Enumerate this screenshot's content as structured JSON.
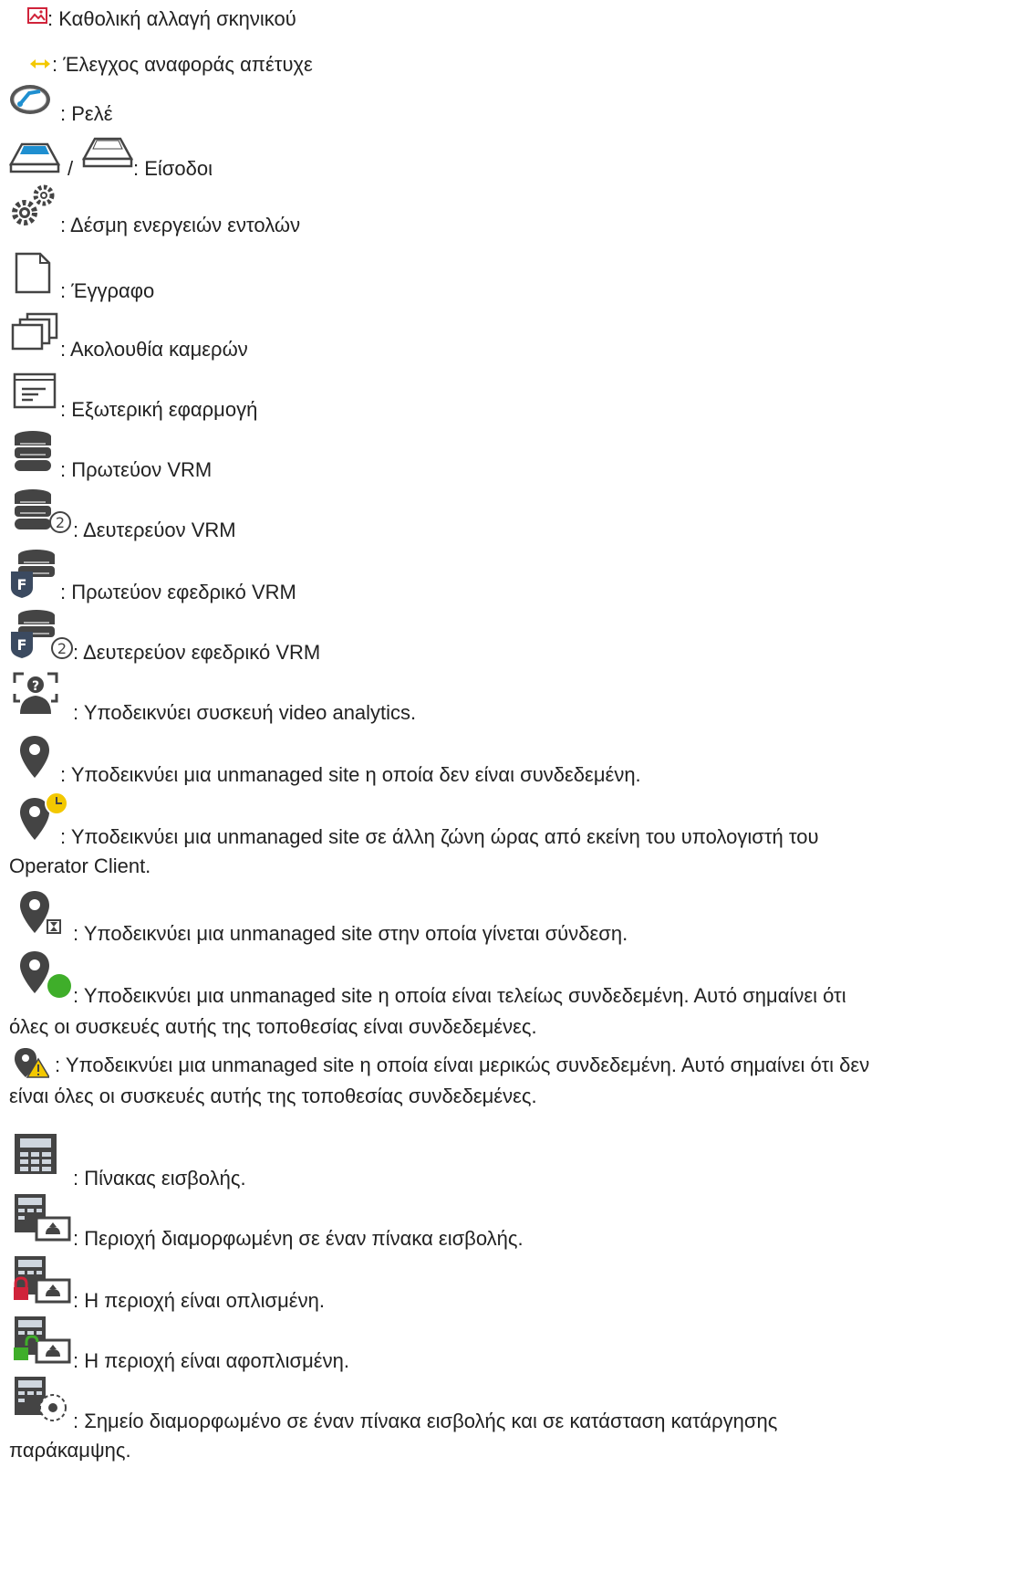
{
  "items": [
    {
      "icon": "scene-change-icon",
      "text": ": Καθολική αλλαγή σκηνικού"
    },
    {
      "icon": "reference-check-failed-icon",
      "text": ": Έλεγχος αναφοράς απέτυχε"
    },
    {
      "icon": "relay-icon",
      "text": ": Ρελέ"
    },
    {
      "icon": "input-icon",
      "separator": "/",
      "text": ": Είσοδοι"
    },
    {
      "icon": "command-script-icon",
      "text": ": Δέσμη ενεργειών εντολών"
    },
    {
      "icon": "document-icon",
      "text": ": Έγγραφο"
    },
    {
      "icon": "camera-sequence-icon",
      "text": ": Ακολουθία καμερών"
    },
    {
      "icon": "external-application-icon",
      "text": ": Εξωτερική εφαρμογή"
    },
    {
      "icon": "primary-vrm-icon",
      "text": ": Πρωτεύον VRM"
    },
    {
      "icon": "secondary-vrm-icon",
      "text": ": Δευτερεύον VRM"
    },
    {
      "icon": "primary-failover-vrm-icon",
      "text": ": Πρωτεύον εφεδρικό VRM"
    },
    {
      "icon": "secondary-failover-vrm-icon",
      "text": ": Δευτερεύον εφεδρικό VRM"
    },
    {
      "icon": "video-analytics-icon",
      "text": ": Υποδεικνύει συσκευή video analytics."
    },
    {
      "icon": "site-disconnected-icon",
      "text": ": Υποδεικνύει μια unmanaged site η οποία δεν είναι συνδεδεμένη."
    },
    {
      "icon": "site-timezone-icon",
      "text": ": Υποδεικνύει μια unmanaged site σε άλλη ζώνη ώρας από εκείνη του υπολογιστή του",
      "text2": "Operator Client."
    },
    {
      "icon": "site-connecting-icon",
      "text": ": Υποδεικνύει μια unmanaged site στην οποία γίνεται σύνδεση."
    },
    {
      "icon": "site-connected-icon",
      "text": ": Υποδεικνύει μια unmanaged site η οποία είναι τελείως συνδεδεμένη. Αυτό σημαίνει ότι",
      "text2": "όλες οι συσκευές αυτής της τοποθεσίας είναι συνδεδεμένες."
    },
    {
      "icon": "site-partially-connected-icon",
      "text": ": Υποδεικνύει μια unmanaged site η οποία είναι μερικώς συνδεδεμένη. Αυτό σημαίνει ότι δεν",
      "text2": "είναι όλες οι συσκευές αυτής της τοποθεσίας συνδεδεμένες."
    },
    {
      "icon": "intrusion-panel-icon",
      "text": ": Πίνακας εισβολής."
    },
    {
      "icon": "intrusion-area-icon",
      "text": ": Περιοχή διαμορφωμένη σε έναν πίνακα εισβολής."
    },
    {
      "icon": "area-armed-icon",
      "text": ": Η περιοχή είναι οπλισμένη."
    },
    {
      "icon": "area-disarmed-icon",
      "text": ": Η περιοχή είναι αφοπλισμένη."
    },
    {
      "icon": "point-bypass-icon",
      "text": ": Σημείο διαμορφωμένο σε έναν πίνακα εισβολής και σε κατάσταση κατάργησης",
      "text2": "παράκαμψης."
    }
  ],
  "colors": {
    "text": "#222222",
    "icon_dark": "#444444",
    "icon_blue": "#1f8fd0",
    "alarm_red": "#d0233a",
    "ok_green": "#3fae2a",
    "warn_yellow": "#f3c800"
  }
}
